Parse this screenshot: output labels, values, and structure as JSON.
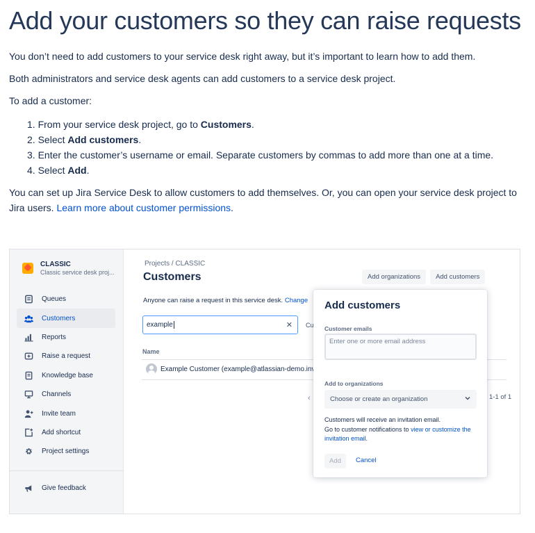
{
  "doc": {
    "title": "Add your customers so they can raise requests",
    "p1": "You don’t need to add customers to your service desk right away, but it’s important to learn how to add them.",
    "p2": "Both administrators and service desk agents can add customers to a service desk project.",
    "p3": "To add a customer:",
    "steps": [
      {
        "num": "1.",
        "pre": "From your service desk project, go to ",
        "bold": "Customers",
        "post": "."
      },
      {
        "num": "2.",
        "pre": "Select ",
        "bold": "Add customers",
        "post": "."
      },
      {
        "num": "3.",
        "pre": "Enter the customer’s username or email. Separate customers by commas to add more than one at a time.",
        "bold": "",
        "post": ""
      },
      {
        "num": "4.",
        "pre": "Select ",
        "bold": "Add",
        "post": "."
      }
    ],
    "p4_text": "You can set up Jira Service Desk to allow customers to add themselves. Or, you can open your service desk project to Jira users. ",
    "p4_link": "Learn more about customer permissions",
    "p4_end": "."
  },
  "screenshot": {
    "project": {
      "name": "CLASSIC",
      "subtitle": "Classic service desk proj..."
    },
    "nav": [
      {
        "label": "Queues",
        "icon": "queues-icon"
      },
      {
        "label": "Customers",
        "icon": "customers-icon",
        "active": true
      },
      {
        "label": "Reports",
        "icon": "reports-icon"
      },
      {
        "label": "Raise a request",
        "icon": "raise-request-icon"
      },
      {
        "label": "Knowledge base",
        "icon": "knowledge-base-icon"
      },
      {
        "label": "Channels",
        "icon": "channels-icon"
      },
      {
        "label": "Invite team",
        "icon": "invite-team-icon"
      },
      {
        "label": "Add shortcut",
        "icon": "add-shortcut-icon"
      },
      {
        "label": "Project settings",
        "icon": "gear-icon"
      }
    ],
    "feedback": {
      "label": "Give feedback",
      "icon": "megaphone-icon"
    },
    "breadcrumb": "Projects  /  CLASSIC",
    "page_title": "Customers",
    "buttons": {
      "add_orgs": "Add organizations",
      "add_customers": "Add customers"
    },
    "notice_text": "Anyone can raise a request in this service desk. ",
    "notice_link": "Change",
    "search_value": "example",
    "search_cutoff": "Cu",
    "column_name": "Name",
    "row_text": "Example Customer (example@atlassian-demo.inv",
    "pager_prev": "‹",
    "pager_count": "1-1 of 1",
    "modal": {
      "title": "Add customers",
      "emails_label": "Customer emails",
      "emails_placeholder": "Enter one or more email address",
      "orgs_label": "Add to organizations",
      "orgs_placeholder": "Choose or create an organization",
      "info_line1": "Customers will receive an invitation email.",
      "info_line2": "Go to customer notifications to ",
      "info_link": "view or customize the invitation email",
      "info_end": ".",
      "add_label": "Add",
      "cancel_label": "Cancel"
    }
  }
}
